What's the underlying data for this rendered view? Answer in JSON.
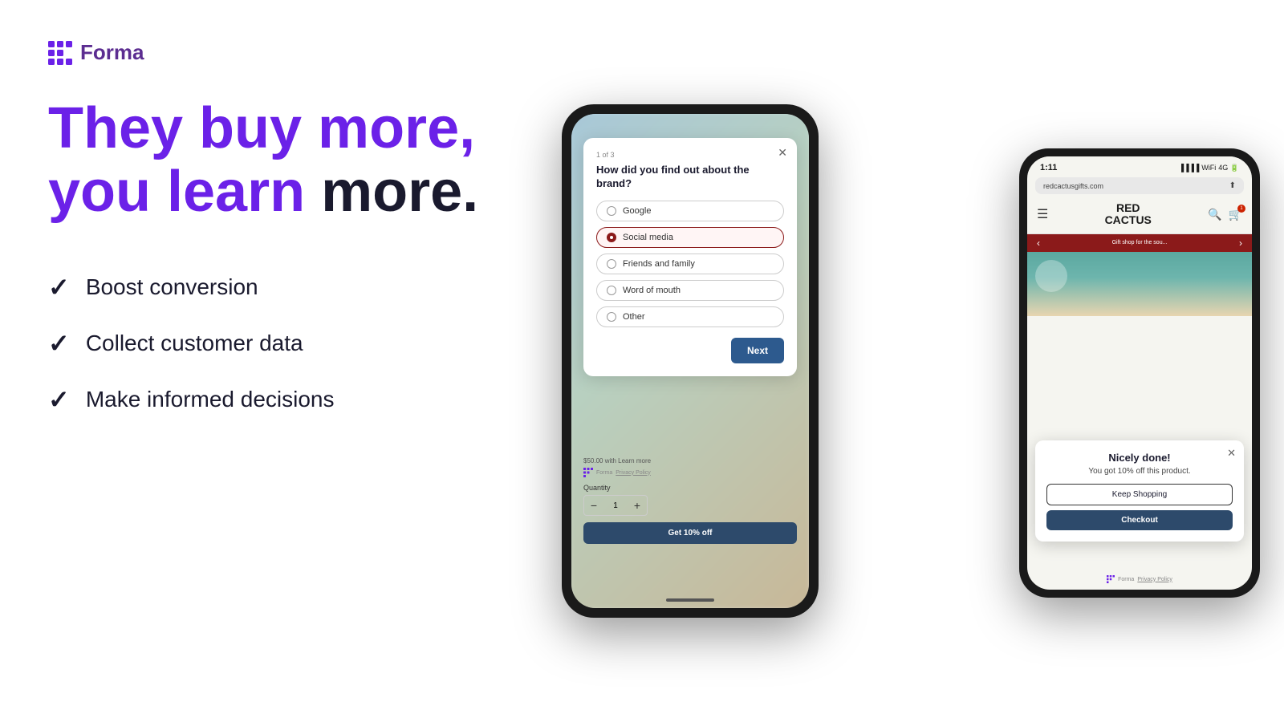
{
  "logo": {
    "text": "Forma"
  },
  "headline": {
    "line1_purple": "They buy more,",
    "line2_purple": "you learn",
    "line2_dark": "more."
  },
  "checklist": {
    "items": [
      {
        "label": "Boost conversion"
      },
      {
        "label": "Collect customer data"
      },
      {
        "label": "Make informed decisions"
      }
    ]
  },
  "survey_phone": {
    "step": "1 of 3",
    "question": "How did you find out about the brand?",
    "options": [
      {
        "label": "Google",
        "selected": false
      },
      {
        "label": "Social media",
        "selected": true
      },
      {
        "label": "Friends and family",
        "selected": false
      },
      {
        "label": "Word of mouth",
        "selected": false
      },
      {
        "label": "Other",
        "selected": false
      }
    ],
    "next_button": "Next",
    "shopify_text": "$50.00 with  Learn more",
    "forma_label": "Forma",
    "privacy_label": "Privacy Policy",
    "quantity_label": "Quantity",
    "quantity_value": "1",
    "discount_button": "Get 10% off"
  },
  "result_phone": {
    "status_time": "1:11",
    "url": "redcactusgifts.com",
    "store_name": "RED\nCACTUS",
    "banner_text": "Gift shop for the sou...",
    "success_title": "Nicely done!",
    "success_subtitle": "You got 10% off this product.",
    "keep_shopping": "Keep Shopping",
    "checkout": "Checkout",
    "forma_label": "Forma",
    "privacy_label": "Privacy Policy"
  },
  "colors": {
    "purple_brand": "#6b21e8",
    "dark_text": "#1a1a2e",
    "navy_btn": "#2d4a6b",
    "red_selected": "#8b1a1a",
    "red_banner": "#8b1a1a"
  }
}
